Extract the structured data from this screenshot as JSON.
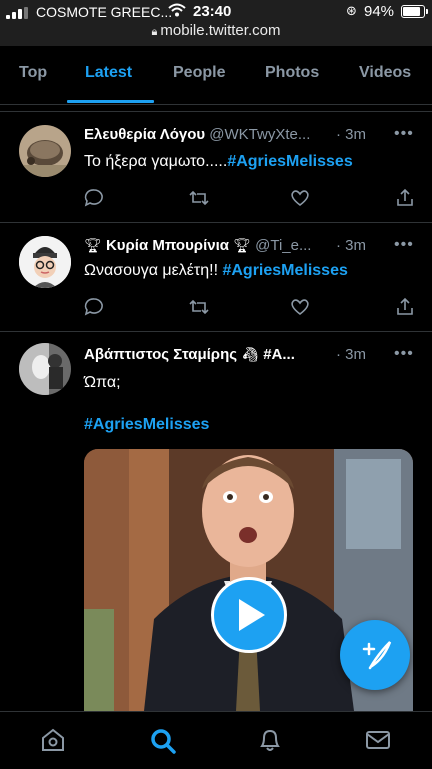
{
  "status_bar": {
    "carrier": "COSMOTE GREEC...",
    "time": "23:40",
    "battery_percent": "94%",
    "battery_level": 0.94,
    "url": "mobile.twitter.com"
  },
  "tabs": [
    {
      "label": "Top",
      "active": false
    },
    {
      "label": "Latest",
      "active": true
    },
    {
      "label": "People",
      "active": false
    },
    {
      "label": "Photos",
      "active": false
    },
    {
      "label": "Videos",
      "active": false
    }
  ],
  "tweets": [
    {
      "name": "Ελευθερία Λόγου",
      "handle": "@WKTwyXte...",
      "time": "· 3m",
      "text": "Το ήξερα γαμωτο.....",
      "hashtag": "#AgriesMelisses"
    },
    {
      "name": "Κυρία Μπουρίνια",
      "handle": "@Ti_e...",
      "time": "· 3m",
      "text": "Ωνασουγα μελέτη!! ",
      "hashtag": "#AgriesMelisses"
    },
    {
      "name": "Αβάπτιστος Σταμίρης",
      "handle": "#A...",
      "time": "· 3m",
      "text": "Ώπα;",
      "hashtag": "#AgriesMelisses"
    }
  ],
  "more_label": "•••",
  "colors": {
    "accent": "#1da1f2",
    "background": "#000000",
    "muted": "#8b98a5",
    "border": "#2f3336"
  }
}
